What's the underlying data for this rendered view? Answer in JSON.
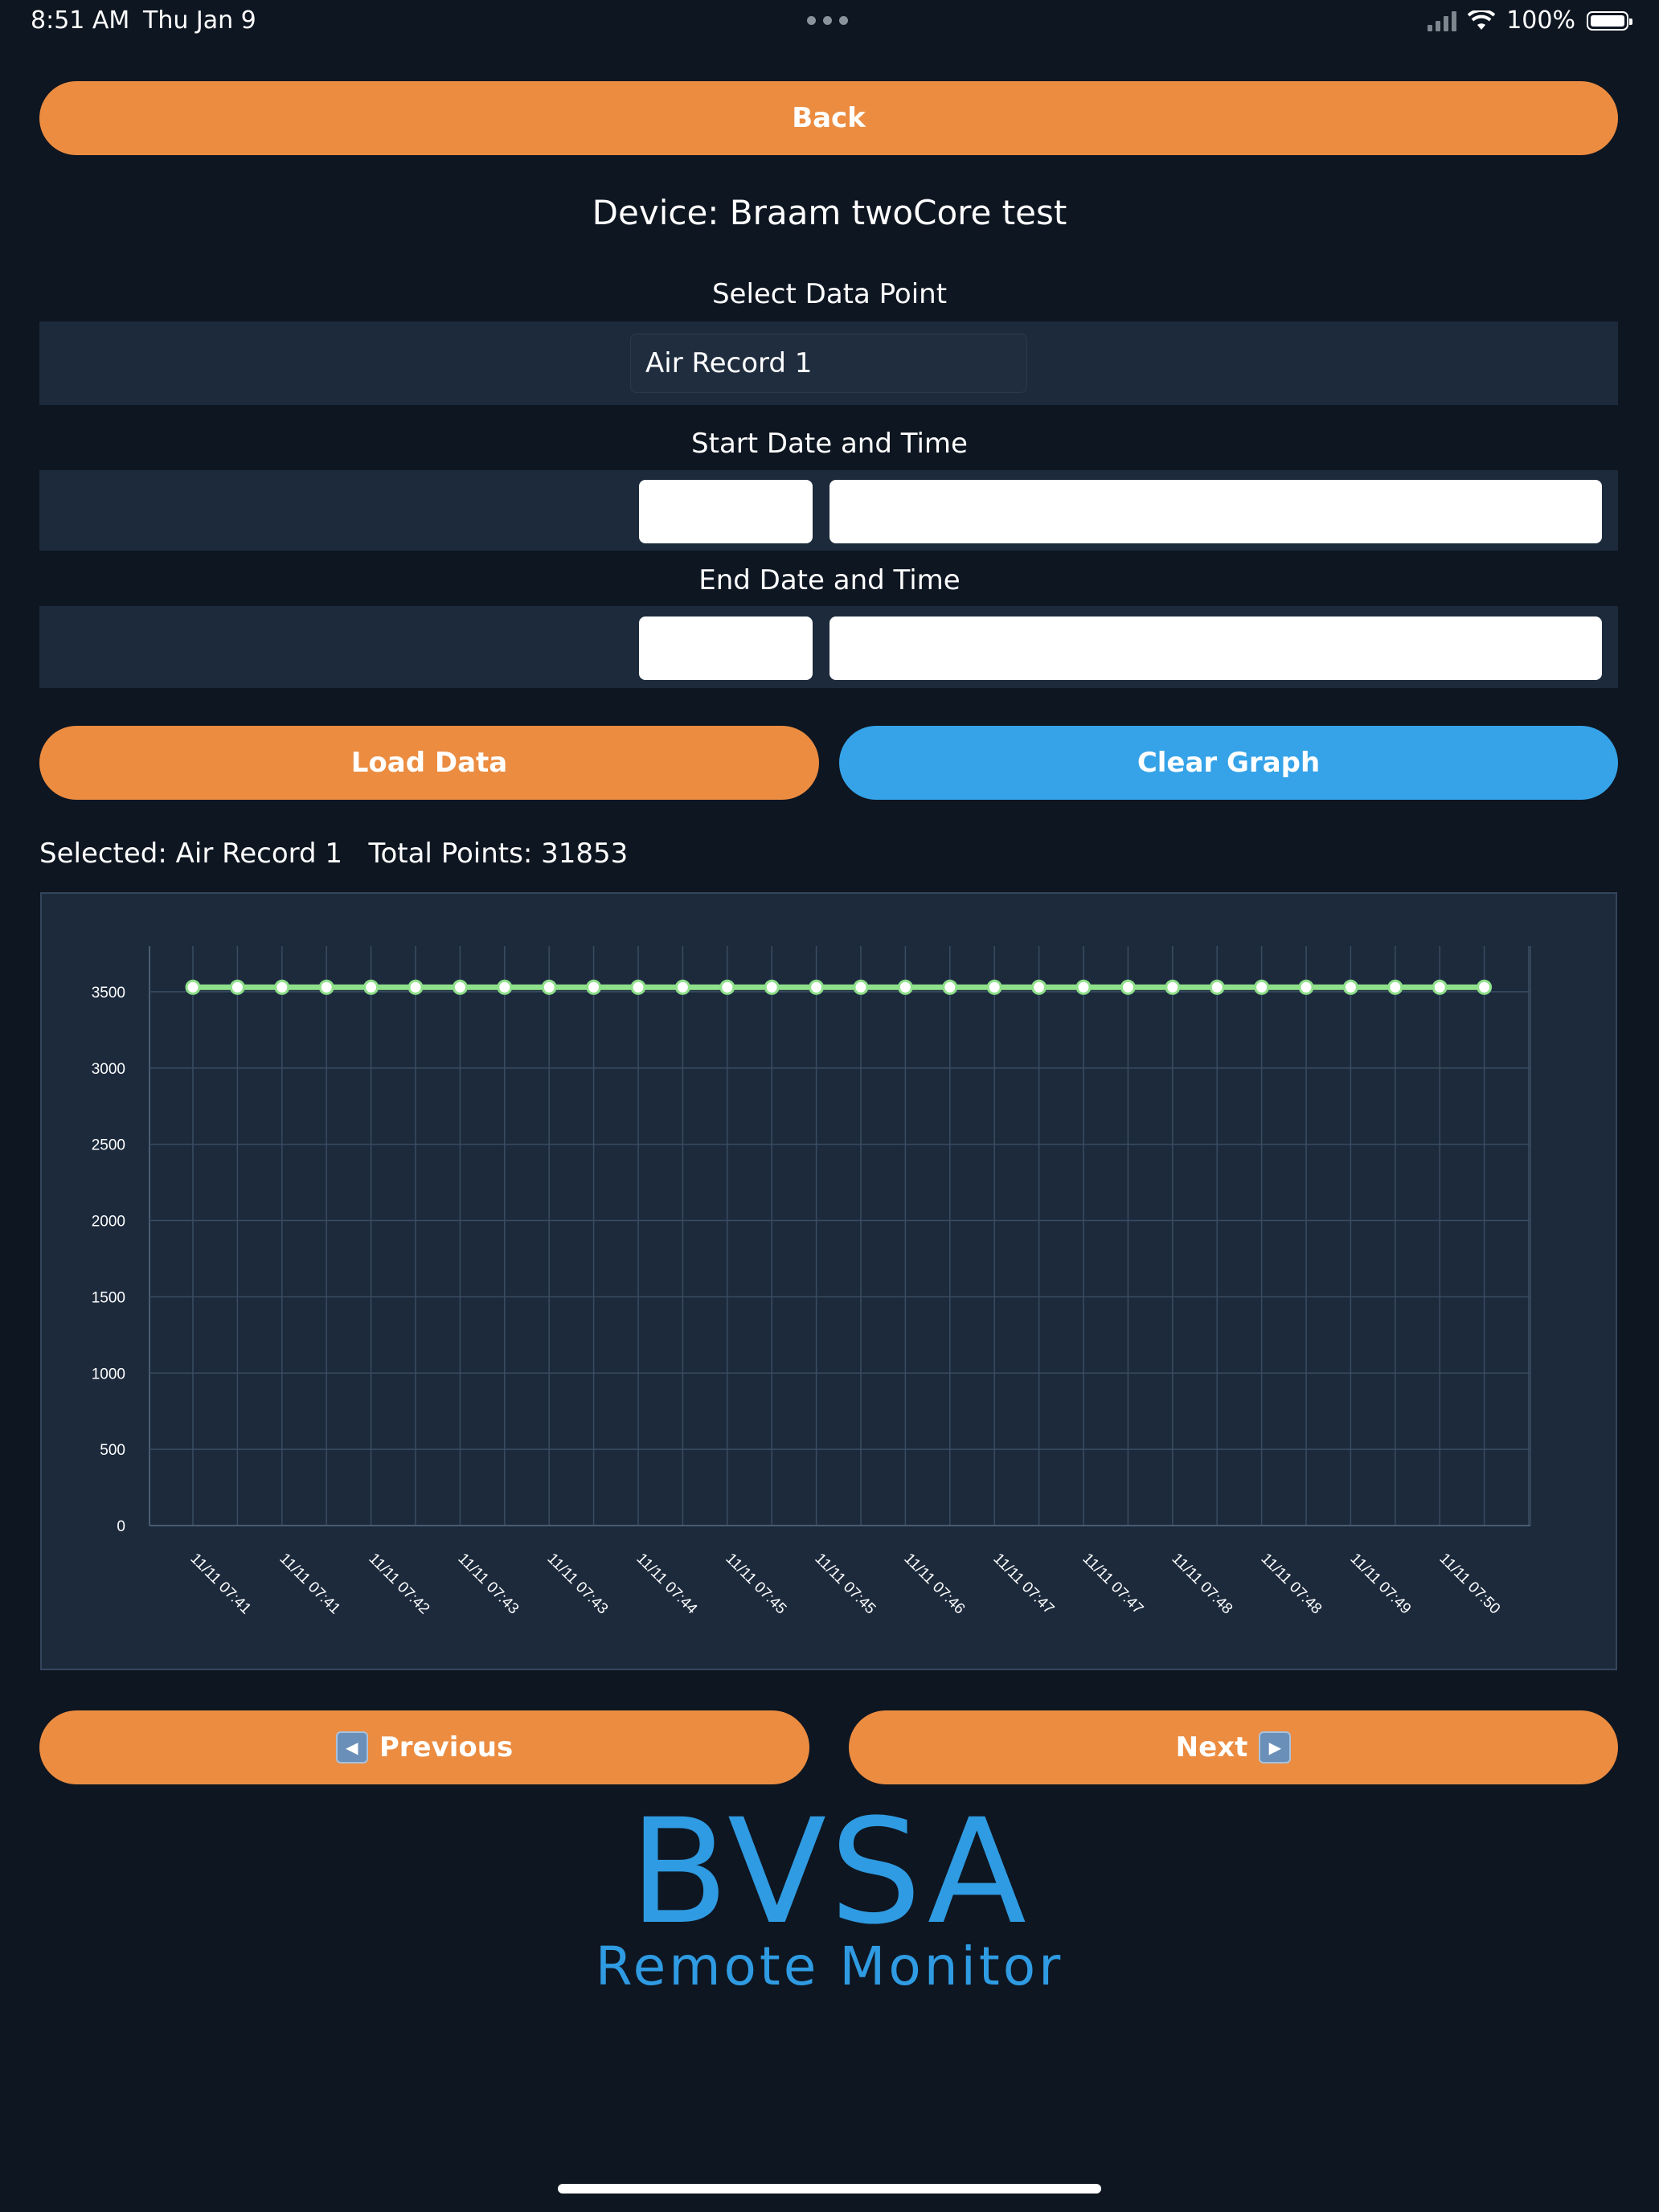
{
  "status_bar": {
    "time": "8:51 AM",
    "date": "Thu Jan 9",
    "battery": "100%"
  },
  "back_label": "Back",
  "device_title": "Device: Braam twoCore test",
  "select_label": "Select Data Point",
  "selected_point": "Air Record 1",
  "start_label": "Start Date and Time",
  "start_date": "",
  "start_time": "",
  "end_label": "End Date and Time",
  "end_date": "",
  "end_time": "",
  "load_label": "Load Data",
  "clear_label": "Clear Graph",
  "info_text": "Selected: Air Record 1   Total Points: 31853",
  "prev_label": "Previous",
  "next_label": "Next",
  "logo_main": "BVSA",
  "logo_sub": "Remote Monitor",
  "colors": {
    "orange": "#eb8c41",
    "blue": "#36a3e8",
    "line": "#8fe08a",
    "background": "#0e1621",
    "panel": "#1c2a3c"
  },
  "chart_data": {
    "type": "line",
    "ylim": [
      0,
      3800
    ],
    "yticks": [
      0,
      500,
      1000,
      1500,
      2000,
      2500,
      3000,
      3500
    ],
    "x_tick_labels": [
      "11/11 07:41",
      "11/11 07:41",
      "11/11 07:42",
      "11/11 07:43",
      "11/11 07:43",
      "11/11 07:44",
      "11/11 07:45",
      "11/11 07:45",
      "11/11 07:46",
      "11/11 07:47",
      "11/11 07:47",
      "11/11 07:48",
      "11/11 07:48",
      "11/11 07:49",
      "11/11 07:50"
    ],
    "grid": true,
    "series": [
      {
        "values": [
          3530,
          3530,
          3530,
          3530,
          3530,
          3530,
          3530,
          3530,
          3530,
          3530,
          3530,
          3530,
          3530,
          3530,
          3530,
          3530,
          3530,
          3530,
          3530,
          3530,
          3530,
          3530,
          3530,
          3530,
          3530,
          3530,
          3530,
          3530,
          3530,
          3530
        ]
      }
    ]
  }
}
